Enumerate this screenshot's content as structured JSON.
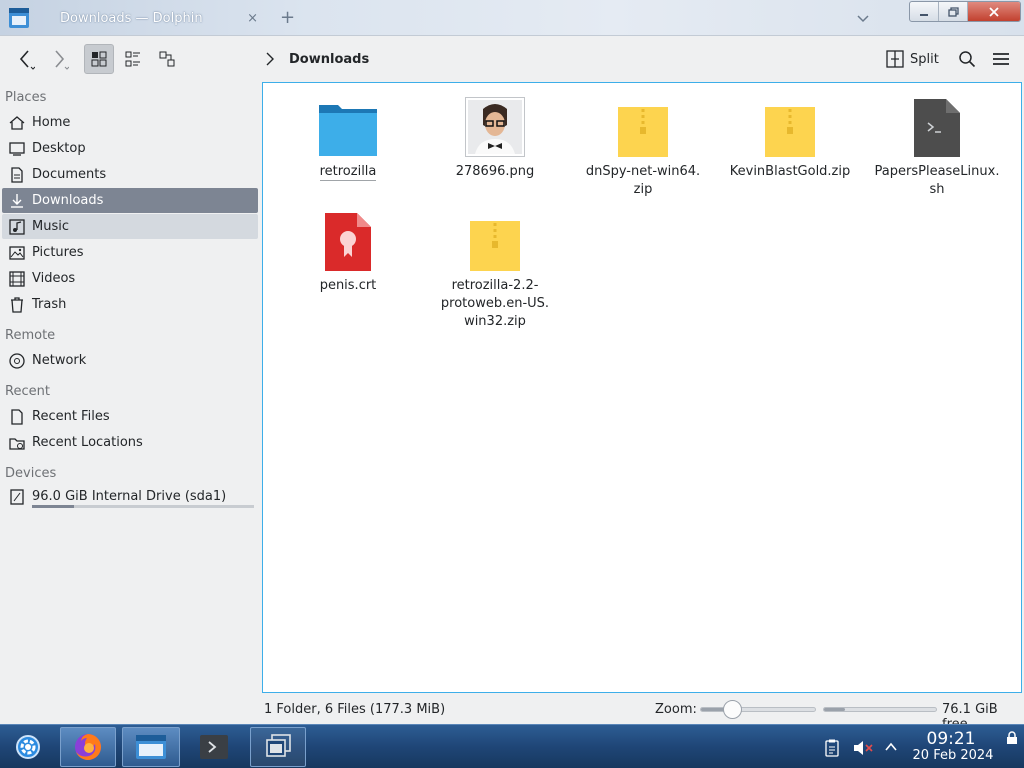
{
  "window": {
    "tab_title": "Downloads — Dolphin",
    "new_tab": "+",
    "close_tab": "×"
  },
  "toolbar": {
    "breadcrumb": "Downloads",
    "split_label": "Split"
  },
  "sidebar": {
    "sections": {
      "places": "Places",
      "remote": "Remote",
      "recent": "Recent",
      "devices": "Devices"
    },
    "places": [
      {
        "label": "Home",
        "icon": "home-icon"
      },
      {
        "label": "Desktop",
        "icon": "desktop-icon"
      },
      {
        "label": "Documents",
        "icon": "documents-icon"
      },
      {
        "label": "Downloads",
        "icon": "downloads-icon",
        "selected": true
      },
      {
        "label": "Music",
        "icon": "music-icon",
        "hovered": true
      },
      {
        "label": "Pictures",
        "icon": "pictures-icon"
      },
      {
        "label": "Videos",
        "icon": "videos-icon"
      },
      {
        "label": "Trash",
        "icon": "trash-icon"
      }
    ],
    "remote": [
      {
        "label": "Network",
        "icon": "network-icon"
      }
    ],
    "recent": [
      {
        "label": "Recent Files",
        "icon": "recent-files-icon"
      },
      {
        "label": "Recent Locations",
        "icon": "recent-locations-icon"
      }
    ],
    "devices": [
      {
        "label": "96.0 GiB Internal Drive (sda1)",
        "icon": "drive-icon",
        "usage_fraction": 0.19
      }
    ]
  },
  "files": [
    {
      "name": "retrozilla",
      "type": "folder"
    },
    {
      "name": "278696.png",
      "type": "image"
    },
    {
      "name": "dnSpy-net-win64.\nzip",
      "type": "zip"
    },
    {
      "name": "KevinBlastGold.zip",
      "type": "zip"
    },
    {
      "name": "PapersPleaseLinux.\nsh",
      "type": "script"
    },
    {
      "name": "penis.crt",
      "type": "certificate"
    },
    {
      "name": "retrozilla-2.2-\nprotoweb.en-US.\nwin32.zip",
      "type": "zip"
    }
  ],
  "statusbar": {
    "summary": "1 Folder, 6 Files (177.3 MiB)",
    "zoom_label": "Zoom:",
    "zoom_fraction": 0.28,
    "free_label": "76.1 GiB free",
    "free_used_fraction": 0.19
  },
  "taskbar": {
    "time": "09:21",
    "date": "20 Feb 2024"
  },
  "colors": {
    "accent": "#3daee9",
    "selection": "#7d8593",
    "taskbar": "#1f4677"
  }
}
